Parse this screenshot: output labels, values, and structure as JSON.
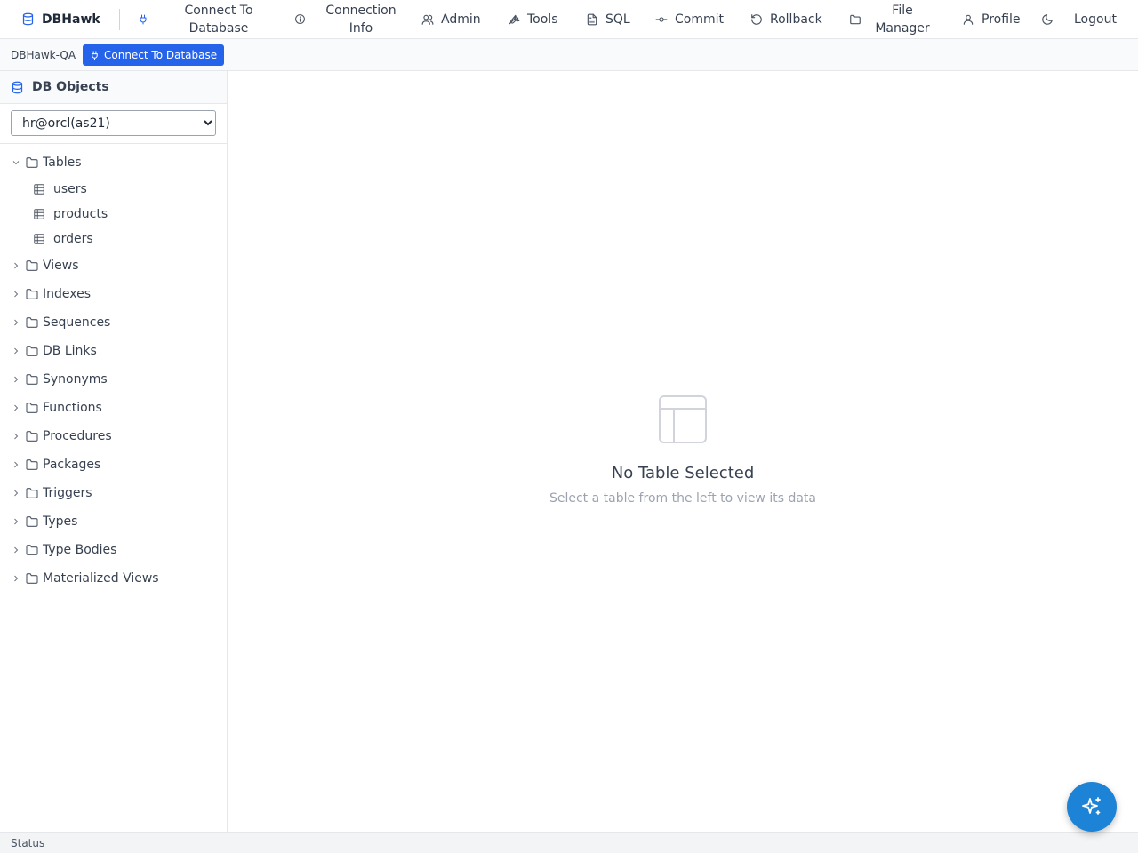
{
  "nav": {
    "brand": "DBHawk",
    "items": [
      {
        "label": "Connect To\nDatabase",
        "icon": "plug-icon"
      },
      {
        "label": "Connection\nInfo",
        "icon": "info-icon"
      },
      {
        "label": "Admin",
        "icon": "users-icon"
      },
      {
        "label": "Tools",
        "icon": "wrench-icon"
      },
      {
        "label": "SQL",
        "icon": "file-text-icon"
      },
      {
        "label": "Commit",
        "icon": "commit-icon"
      },
      {
        "label": "Rollback",
        "icon": "rotate-ccw-icon"
      },
      {
        "label": "File\nManager",
        "icon": "folder-icon"
      },
      {
        "label": "Profile",
        "icon": "user-icon"
      },
      {
        "label": "",
        "icon": "moon-icon"
      },
      {
        "label": "Logout",
        "icon": ""
      }
    ]
  },
  "subbar": {
    "connection_name": "DBHawk-QA",
    "connect_button": "Connect To Database"
  },
  "sidebar": {
    "title": "DB Objects",
    "selected_connection": "hr@orcl(as21)",
    "tree": [
      {
        "label": "Tables",
        "expanded": true,
        "children": [
          "users",
          "products",
          "orders"
        ]
      },
      {
        "label": "Views",
        "expanded": false
      },
      {
        "label": "Indexes",
        "expanded": false
      },
      {
        "label": "Sequences",
        "expanded": false
      },
      {
        "label": "DB Links",
        "expanded": false
      },
      {
        "label": "Synonyms",
        "expanded": false
      },
      {
        "label": "Functions",
        "expanded": false
      },
      {
        "label": "Procedures",
        "expanded": false
      },
      {
        "label": "Packages",
        "expanded": false
      },
      {
        "label": "Triggers",
        "expanded": false
      },
      {
        "label": "Types",
        "expanded": false
      },
      {
        "label": "Type Bodies",
        "expanded": false
      },
      {
        "label": "Materialized Views",
        "expanded": false
      }
    ]
  },
  "main": {
    "empty_title": "No Table Selected",
    "empty_subtitle": "Select a table from the left to view its data"
  },
  "status": {
    "text": "Status"
  },
  "colors": {
    "accent": "#2563eb",
    "fab": "#1d83d6"
  }
}
